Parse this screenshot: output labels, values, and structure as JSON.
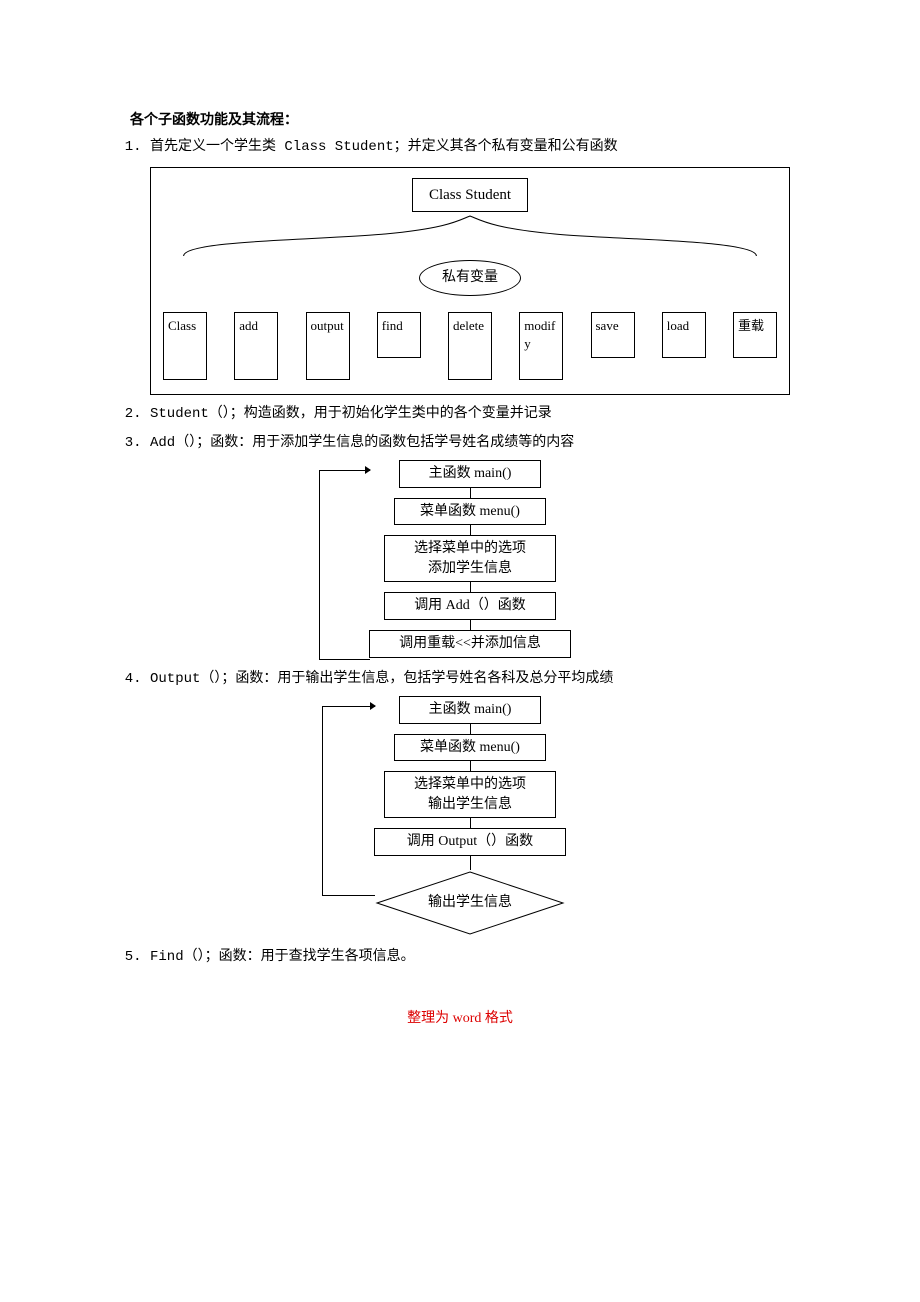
{
  "heading": "各个子函数功能及其流程：",
  "items": {
    "i1": "首先定义一个学生类 Class Student；并定义其各个私有变量和公有函数",
    "i2": "Student（）；构造函数，用于初始化学生类中的各个变量并记录",
    "i3": "Add（）；函数：用于添加学生信息的函数包括学号姓名成绩等的内容",
    "i4": "Output（）；函数：用于输出学生信息，包括学号姓名各科及总分平均成绩",
    "i5": "Find（）；函数：用于查找学生各项信息。"
  },
  "diagram1": {
    "top": "Class Student",
    "middle": "私有变量",
    "methods": {
      "m0": "Class",
      "m1": "add",
      "m2": "output",
      "m3": "find",
      "m4": "delete",
      "m5": "modify",
      "m6": "save",
      "m7": "load",
      "m8": "重载"
    }
  },
  "flowchart_add": {
    "b1": "主函数 main()",
    "b2": "菜单函数 menu()",
    "b3_l1": "选择菜单中的选项",
    "b3_l2": "添加学生信息",
    "b4": "调用 Add（）函数",
    "b5": "调用重载<<并添加信息"
  },
  "flowchart_output": {
    "b1": "主函数 main()",
    "b2": "菜单函数 menu()",
    "b3_l1": "选择菜单中的选项",
    "b3_l2": "输出学生信息",
    "b4": "调用 Output（）函数",
    "diamond": "输出学生信息"
  },
  "footer": "整理为 word 格式"
}
